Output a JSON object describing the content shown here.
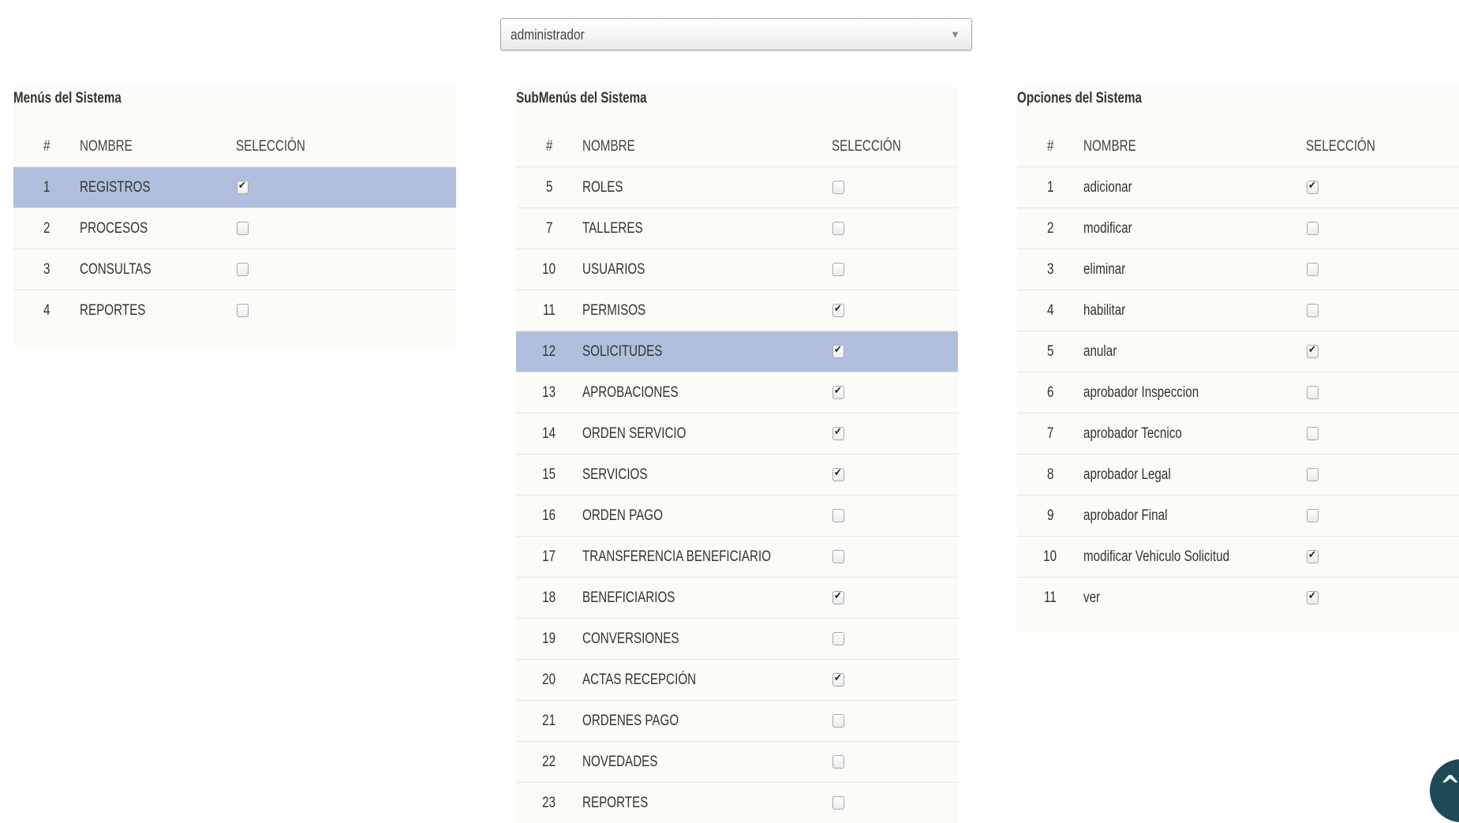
{
  "role_select": {
    "value": "administrador"
  },
  "menus": {
    "title": "Menús del Sistema",
    "headers": {
      "num": "#",
      "name": "NOMBRE",
      "selection": "SELECCIÓN"
    },
    "rows": [
      {
        "num": "1",
        "name": "REGISTROS",
        "checked": true,
        "selected": true
      },
      {
        "num": "2",
        "name": "PROCESOS",
        "checked": false,
        "selected": false
      },
      {
        "num": "3",
        "name": "CONSULTAS",
        "checked": false,
        "selected": false
      },
      {
        "num": "4",
        "name": "REPORTES",
        "checked": false,
        "selected": false
      }
    ]
  },
  "submenus": {
    "title": "SubMenús del Sistema",
    "headers": {
      "num": "#",
      "name": "NOMBRE",
      "selection": "SELECCIÓN"
    },
    "rows": [
      {
        "num": "5",
        "name": "ROLES",
        "checked": false,
        "selected": false
      },
      {
        "num": "7",
        "name": "TALLERES",
        "checked": false,
        "selected": false
      },
      {
        "num": "10",
        "name": "USUARIOS",
        "checked": false,
        "selected": false
      },
      {
        "num": "11",
        "name": "PERMISOS",
        "checked": true,
        "selected": false
      },
      {
        "num": "12",
        "name": "SOLICITUDES",
        "checked": true,
        "selected": true
      },
      {
        "num": "13",
        "name": "APROBACIONES",
        "checked": true,
        "selected": false
      },
      {
        "num": "14",
        "name": "ORDEN SERVICIO",
        "checked": true,
        "selected": false
      },
      {
        "num": "15",
        "name": "SERVICIOS",
        "checked": true,
        "selected": false
      },
      {
        "num": "16",
        "name": "ORDEN PAGO",
        "checked": false,
        "selected": false
      },
      {
        "num": "17",
        "name": "TRANSFERENCIA BENEFICIARIO",
        "checked": false,
        "selected": false
      },
      {
        "num": "18",
        "name": "BENEFICIARIOS",
        "checked": true,
        "selected": false
      },
      {
        "num": "19",
        "name": "CONVERSIONES",
        "checked": false,
        "selected": false
      },
      {
        "num": "20",
        "name": "ACTAS RECEPCIÓN",
        "checked": true,
        "selected": false
      },
      {
        "num": "21",
        "name": "ORDENES PAGO",
        "checked": false,
        "selected": false
      },
      {
        "num": "22",
        "name": "NOVEDADES",
        "checked": false,
        "selected": false
      },
      {
        "num": "23",
        "name": "REPORTES",
        "checked": false,
        "selected": false
      }
    ]
  },
  "options": {
    "title": "Opciones del Sistema",
    "headers": {
      "num": "#",
      "name": "NOMBRE",
      "selection": "SELECCIÓN"
    },
    "rows": [
      {
        "num": "1",
        "name": "adicionar",
        "checked": true,
        "selected": false
      },
      {
        "num": "2",
        "name": "modificar",
        "checked": false,
        "selected": false
      },
      {
        "num": "3",
        "name": "eliminar",
        "checked": false,
        "selected": false
      },
      {
        "num": "4",
        "name": "habilitar",
        "checked": false,
        "selected": false
      },
      {
        "num": "5",
        "name": "anular",
        "checked": true,
        "selected": false
      },
      {
        "num": "6",
        "name": "aprobador Inspeccion",
        "checked": false,
        "selected": false
      },
      {
        "num": "7",
        "name": "aprobador Tecnico",
        "checked": false,
        "selected": false
      },
      {
        "num": "8",
        "name": "aprobador Legal",
        "checked": false,
        "selected": false
      },
      {
        "num": "9",
        "name": "aprobador Final",
        "checked": false,
        "selected": false
      },
      {
        "num": "10",
        "name": "modificar Vehiculo Solicitud",
        "checked": true,
        "selected": false
      },
      {
        "num": "11",
        "name": "ver",
        "checked": true,
        "selected": false
      }
    ]
  },
  "colors": {
    "selected_row": "#b0bfdd",
    "scroll_button": "#1e4a57"
  },
  "icons": {
    "dropdown": "chevron-down-icon",
    "scroll_top": "chevron-up-icon",
    "check": "check-icon"
  }
}
